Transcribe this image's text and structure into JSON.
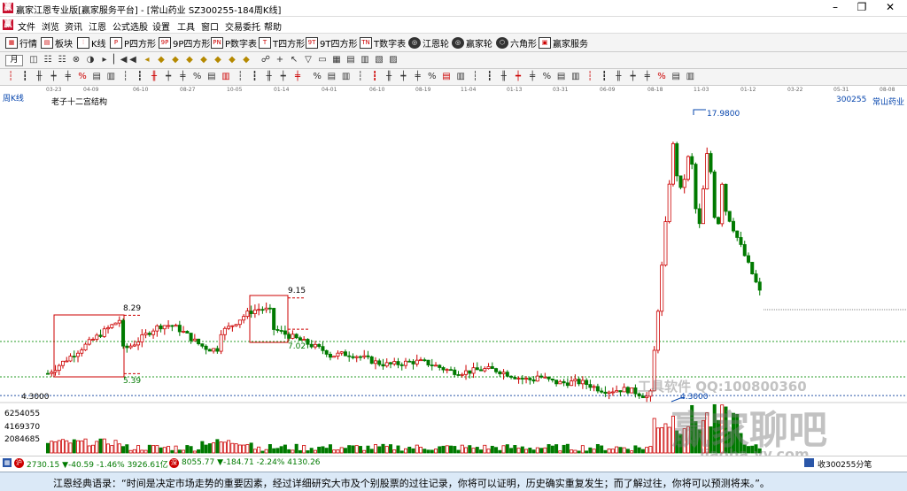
{
  "window": {
    "title": "赢家江恩专业版[赢家服务平台] - [常山药业  SZ300255-184周K线]",
    "minimize": "–",
    "restore": "❐",
    "close": "✕"
  },
  "menu": [
    "文件",
    "浏览",
    "资讯",
    "江恩",
    "公式选股",
    "设置",
    "工具",
    "窗口",
    "交易委托",
    "帮助"
  ],
  "toolbar1": [
    {
      "label": "行情",
      "icon": "grid-icon"
    },
    {
      "label": "板块",
      "icon": "blocks-icon"
    },
    {
      "label": "K线",
      "icon": "candle-icon"
    },
    {
      "label": "P四方形",
      "icon": "P",
      "badge": "P"
    },
    {
      "label": "9P四方形",
      "icon": "9P",
      "badge": "9P"
    },
    {
      "label": "P数字表",
      "icon": "PN",
      "badge": "PN"
    },
    {
      "label": "T四方形",
      "icon": "T",
      "badge": "T"
    },
    {
      "label": "9T四方形",
      "icon": "9T",
      "badge": "9T"
    },
    {
      "label": "T数字表",
      "icon": "TN",
      "badge": "TN"
    },
    {
      "label": "江恩轮",
      "icon": "wheel-icon",
      "badge": "◎"
    },
    {
      "label": "赢家轮",
      "icon": "wheel2-icon",
      "badge": "◎"
    },
    {
      "label": "六角形",
      "icon": "hexagon-icon",
      "badge": "⬡"
    },
    {
      "label": "赢家服务",
      "icon": "service-icon",
      "badge": "▣"
    }
  ],
  "period_selector": "月",
  "date_axis": [
    "03-23",
    "04-09",
    "06-10",
    "08-27",
    "10-05",
    "01-14",
    "04-01",
    "06-10",
    "08-19",
    "11-04",
    "01-13",
    "03-31",
    "06-09",
    "08-18",
    "11-03",
    "01-12",
    "03-22",
    "05-31",
    "08-08"
  ],
  "chart_header": {
    "period": "周K线",
    "structure": "老子十二宫结构",
    "code": "300255",
    "name": "常山药业"
  },
  "annotations": {
    "high": "17.9800",
    "box1_high": "8.29",
    "box1_low": "5.39",
    "box2_high": "9.15",
    "box2_low": "7.02",
    "low": "4.3000"
  },
  "price_axis": {
    "low_label": "4.3000",
    "volume_labels": [
      "6254055",
      "4169370",
      "2084685"
    ]
  },
  "chart_data": {
    "type": "candlestick",
    "title": "常山药业 300255 周K线",
    "ylim": [
      4.0,
      18.5
    ],
    "high": 17.98,
    "low": 4.3,
    "levels": [
      8.29,
      5.39,
      9.15,
      7.02,
      4.3
    ],
    "volume_axis": [
      6254055,
      4169370,
      2084685
    ]
  },
  "status": {
    "sh": "2730.15 ▼-40.59 -1.46% 3926.61亿",
    "sz": "8055.77 ▼-184.71 -2.24% 4130.26",
    "right": "收300255分笔"
  },
  "quote": "江恩经典语录：“时间是决定市场走势的重要因素，经过详细研究大市及个别股票的过往记录，你将可以证明，历史确实重复发生；而了解过往，你将可以预测将来。”。",
  "watermark": {
    "line1": "工具软件  QQ:100800360",
    "line2": "赢家聊吧",
    "line3": "liaoba.yy.com"
  }
}
